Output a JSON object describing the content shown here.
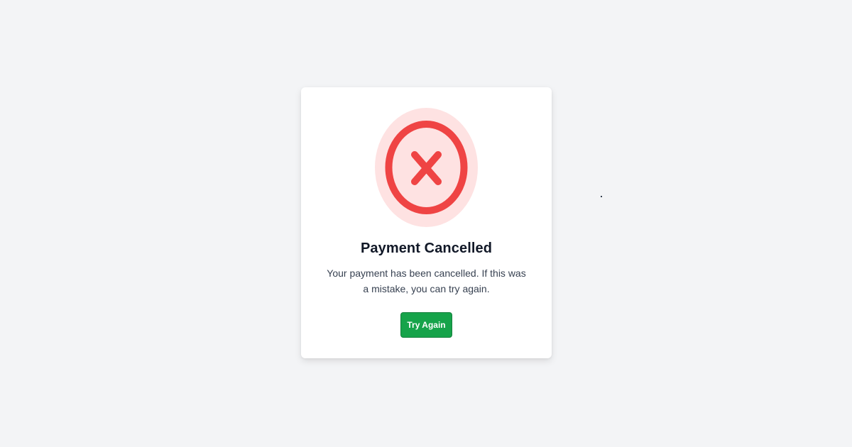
{
  "status": {
    "icon": "x-circle-icon",
    "title": "Payment Cancelled",
    "message": "Your payment has been cancelled. If this was a mistake, you can try again."
  },
  "actions": {
    "try_again_label": "Try Again"
  },
  "colors": {
    "background": "#f3f4f6",
    "card": "#ffffff",
    "error_red": "#ef4444",
    "error_red_light": "#fee2e2",
    "success_green": "#16a34a",
    "title_text": "#111827",
    "body_text": "#374151"
  }
}
